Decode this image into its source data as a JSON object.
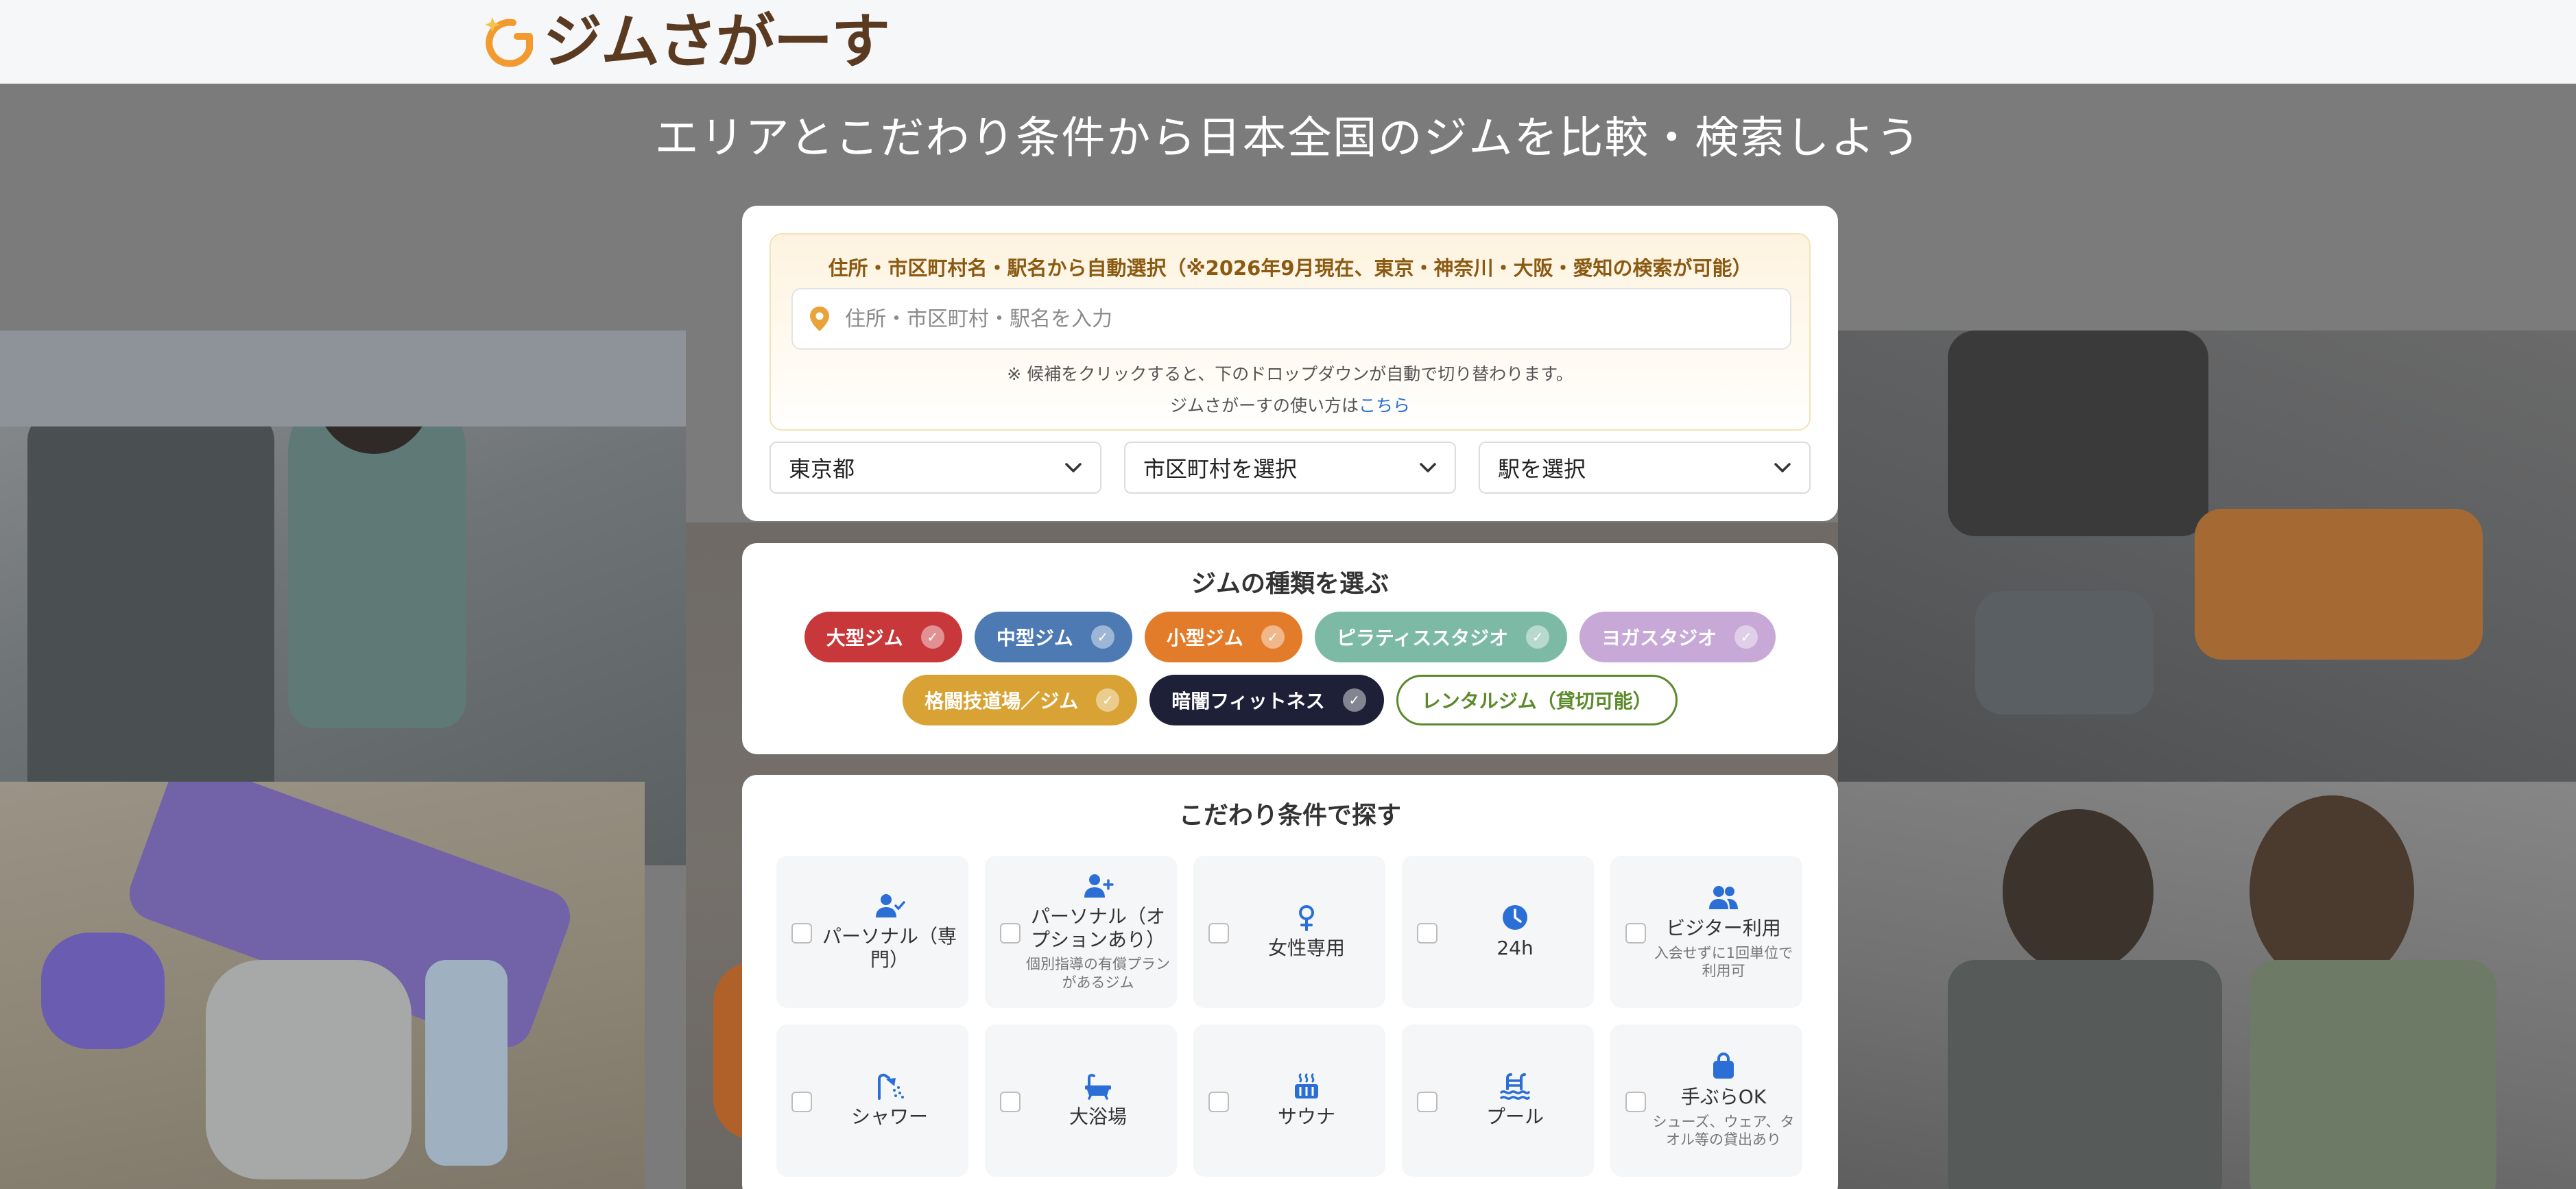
{
  "header": {
    "logo_text": "ジムさがーす"
  },
  "hero": {
    "title": "エリアとこだわり条件から日本全国のジムを比較・検索しよう"
  },
  "location": {
    "heading": "住所・市区町村名・駅名から自動選択（※2026年9月現在、東京・神奈川・大阪・愛知の検索が可能）",
    "input_placeholder": "住所・市区町村・駅名を入力",
    "note": "※ 候補をクリックすると、下のドロップダウンが自動で切り替わります。",
    "help_prefix": "ジムさがーすの使い方は",
    "help_link": "こちら",
    "prefecture": "東京都",
    "city": "市区町村を選択",
    "station": "駅を選択"
  },
  "types": {
    "title": "ジムの種類を選ぶ",
    "chips": [
      {
        "label": "大型ジム",
        "color": "#c8373a",
        "selected": true
      },
      {
        "label": "中型ジム",
        "color": "#4d7ab3",
        "selected": true
      },
      {
        "label": "小型ジム",
        "color": "#e27c2a",
        "selected": true
      },
      {
        "label": "ピラティススタジオ",
        "color": "#7cbaa6",
        "selected": true
      },
      {
        "label": "ヨガスタジオ",
        "color": "#c7a8d6",
        "selected": true
      },
      {
        "label": "格闘技道場／ジム",
        "color": "#d9a234",
        "selected": true
      },
      {
        "label": "暗闇フィットネス",
        "color": "#1e2038",
        "selected": true
      },
      {
        "label": "レンタルジム（貸切可能）",
        "color": "#5b8a2a",
        "selected": false
      }
    ]
  },
  "features": {
    "title": "こだわり条件で探す",
    "items": [
      {
        "label": "パーソナル（専門）",
        "sub": "",
        "icon": "user-check-icon"
      },
      {
        "label": "パーソナル（オプションあり）",
        "sub": "個別指導の有償プランがあるジム",
        "icon": "user-plus-icon"
      },
      {
        "label": "女性専用",
        "sub": "",
        "icon": "female-icon"
      },
      {
        "label": "24h",
        "sub": "",
        "icon": "clock-icon"
      },
      {
        "label": "ビジター利用",
        "sub": "入会せずに1回単位で利用可",
        "icon": "users-icon"
      },
      {
        "label": "シャワー",
        "sub": "",
        "icon": "shower-icon"
      },
      {
        "label": "大浴場",
        "sub": "",
        "icon": "bath-icon"
      },
      {
        "label": "サウナ",
        "sub": "",
        "icon": "sauna-icon"
      },
      {
        "label": "プール",
        "sub": "",
        "icon": "pool-icon"
      },
      {
        "label": "手ぶらOK",
        "sub": "シューズ、ウェア、タオル等の貸出あり",
        "icon": "bag-icon"
      }
    ]
  }
}
